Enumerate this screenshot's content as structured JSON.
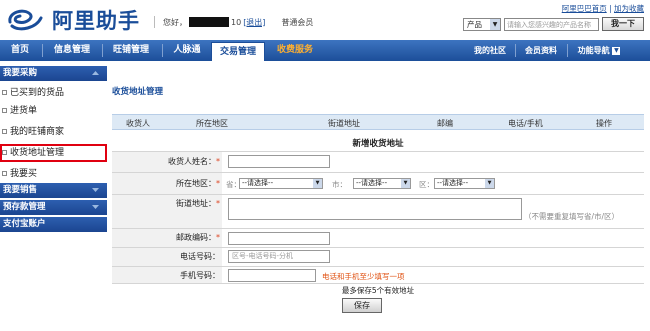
{
  "header": {
    "logo_text": "阿里助手",
    "greeting": "您好，",
    "greeting_suffix": "10",
    "logout": "[退出]",
    "member_level": "普通会员",
    "top_link_home": "阿里巴巴首页",
    "top_link_fav": "加为收藏",
    "search_category": "产品",
    "search_placeholder": "请输入您感兴趣的产品名称",
    "search_button": "我一下"
  },
  "nav": {
    "items": [
      "首页",
      "信息管理",
      "旺铺管理",
      "人脉通",
      "交易管理",
      "收费服务"
    ],
    "active": "交易管理",
    "right_items": [
      "我的社区",
      "会员资料",
      "功能导航"
    ]
  },
  "sidebar": {
    "sections": [
      {
        "title": "我要采购",
        "items": [
          "已买到的货品",
          "进货单",
          "我的旺铺商家",
          "收货地址管理",
          "我要买"
        ]
      },
      {
        "title": "我要销售"
      },
      {
        "title": "预存款管理"
      },
      {
        "title": "支付宝账户"
      }
    ],
    "selected": "收货地址管理"
  },
  "main": {
    "title": "收货地址管理",
    "table_headers": [
      "收货人",
      "所在地区",
      "街道地址",
      "邮编",
      "电话/手机",
      "操作"
    ],
    "form_title": "新增收货地址",
    "fields": {
      "receiver_label": "收货人姓名：",
      "region_label": "所在地区：",
      "province_label": "省：",
      "city_label": "市：",
      "district_label": "区：",
      "select_default": "--请选择--",
      "street_label": "街道地址：",
      "street_hint": "（不需要重复填写省/市/区）",
      "zip_label": "邮政编码：",
      "phone_label": "电话号码：",
      "phone_placeholder": "区号-电话号码-分机",
      "mobile_label": "手机号码：",
      "mobile_hint": "电话和手机至少填写一项",
      "required_mark": "*"
    },
    "note": "最多保存5个有效地址",
    "save_button": "保存"
  },
  "colors": {
    "nav_blue": "#1c4e99",
    "link_blue": "#1a4d99",
    "highlight_red": "#e00010",
    "hint_orange": "#e05010"
  }
}
